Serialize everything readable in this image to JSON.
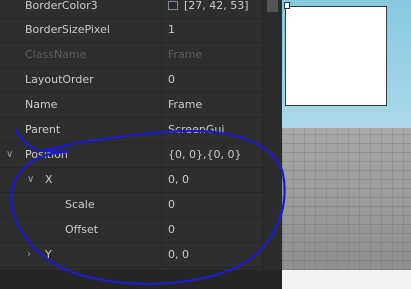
{
  "properties": [
    {
      "name": "BorderColor3",
      "value": "[27, 42, 53]",
      "color": "#1b2a35"
    },
    {
      "name": "BorderSizePixel",
      "value": "1"
    },
    {
      "name": "ClassName",
      "value": "Frame",
      "disabled": true
    },
    {
      "name": "LayoutOrder",
      "value": "0"
    },
    {
      "name": "Name",
      "value": "Frame"
    },
    {
      "name": "Parent",
      "value": "ScreenGui"
    },
    {
      "name": "Position",
      "value": "{0, 0},{0, 0}",
      "expanded": true
    },
    {
      "name": "X",
      "value": "0, 0",
      "expanded": true
    },
    {
      "name": "Scale",
      "value": "0"
    },
    {
      "name": "Offset",
      "value": "0"
    },
    {
      "name": "Y",
      "value": "0, 0",
      "expanded": false
    }
  ],
  "annotation_color": "#1c1ccc",
  "colors": {
    "panel": "#2e2e2e",
    "text": "#cccccc",
    "disabled_text": "#5f5f5f",
    "sky": "#87c8e0",
    "ground": "#9a9c9e"
  }
}
